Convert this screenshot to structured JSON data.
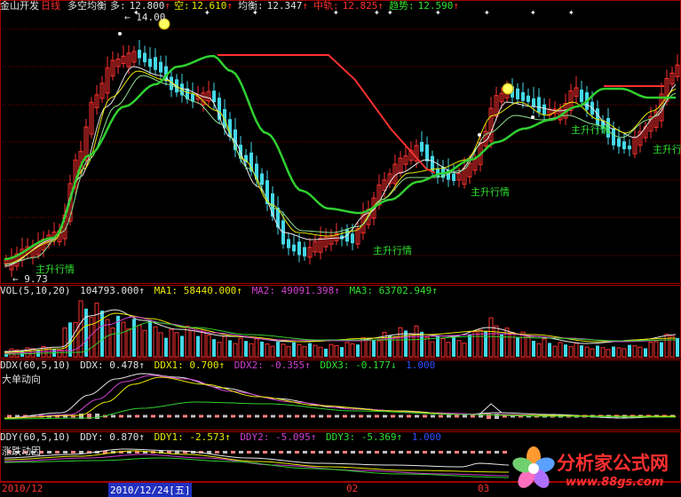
{
  "colors": {
    "bg": "#000000",
    "border": "#a00000",
    "up": "#ff3030",
    "down": "#44d8e8",
    "white": "#e8e8e8",
    "yellow": "#e8e800",
    "green": "#30d030",
    "magenta": "#d040d0",
    "label_green": "#30e030",
    "blue": "#3050ff"
  },
  "main": {
    "title": "金山开发",
    "period": "日线",
    "indicator": "多空均衡",
    "duo_label": "多:",
    "duo_value": "12.800",
    "kong_label": "空:",
    "kong_value": "12.610",
    "junheng_label": "均衡:",
    "junheng_value": "12.347",
    "zhongshu_label": "中轨:",
    "zhongshu_value": "12.825",
    "qushi_label": "趋势:",
    "qushi_value": "12.590",
    "high_mark": "14.00",
    "low_mark": "9.73",
    "labels": [
      "主升行情",
      "主升行情",
      "主升行情",
      "主升行情",
      "主升行情"
    ]
  },
  "vol": {
    "name": "VOL(5,10,20)",
    "v": "104793.000↑",
    "ma1": "MA1: 58440.000↑",
    "ma2": "MA2: 49091.398↑",
    "ma3": "MA3: 63702.949↑"
  },
  "ddx": {
    "name": "DDX(60,5,10)",
    "ddx": "DDX: 0.478↑",
    "ddx1": "DDX1: 0.700↑",
    "ddx2": "DDX2: -0.355↑",
    "ddx3": "DDX3: -0.177↓",
    "last": "1.000",
    "caption": "大单动向"
  },
  "ddy": {
    "name": "DDY(60,5,10)",
    "ddy": "DDY: 0.870↑",
    "ddy1": "DDY1: -2.573↑",
    "ddy2": "DDY2: -5.095↑",
    "ddy3": "DDY3: -5.369↑",
    "last": "1.000",
    "caption": "涨跌动因"
  },
  "axis": {
    "d1": "2010/12",
    "d2": "2010/12/24[五]",
    "d3": "02",
    "d4": "03"
  },
  "logo": {
    "text": "分析家公式网",
    "url": "www.88gs.com"
  }
}
